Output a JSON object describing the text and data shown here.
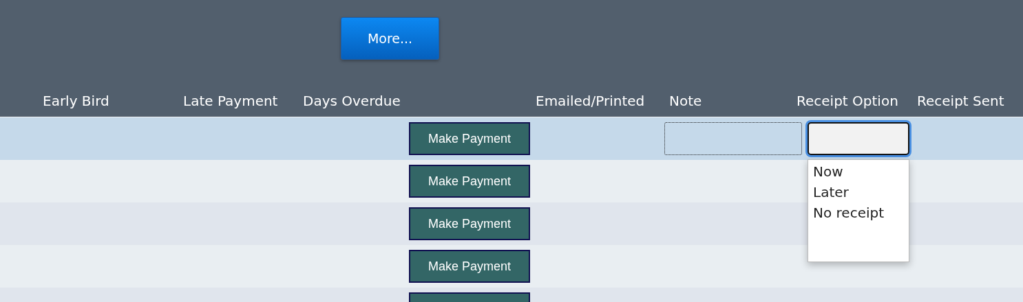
{
  "toolbar": {
    "more_button": "More..."
  },
  "table": {
    "columns": [
      "Early Bird",
      "Late Payment",
      "Days Overdue",
      "Emailed/Printed",
      "Note",
      "Receipt Option",
      "Receipt Sent"
    ],
    "rows": [
      {
        "selected": true,
        "button": "Make Payment",
        "note_field": true,
        "receipt_select": true
      },
      {
        "selected": false,
        "button": "Make Payment"
      },
      {
        "selected": false,
        "button": "Make Payment"
      },
      {
        "selected": false,
        "button": "Make Payment"
      },
      {
        "selected": false
      }
    ]
  },
  "receipt_dropdown": {
    "options": [
      "Now",
      "Later",
      "No receipt"
    ]
  }
}
